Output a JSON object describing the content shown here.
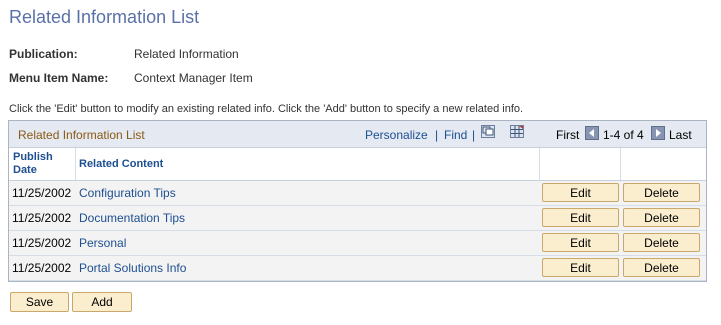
{
  "page": {
    "title": "Related Information List"
  },
  "fields": [
    {
      "label": "Publication:",
      "value": "Related Information"
    },
    {
      "label": "Menu Item Name:",
      "value": "Context Manager Item"
    }
  ],
  "instructions": "Click the 'Edit' button to modify an existing related info. Click the 'Add' button to specify a new related info.",
  "grid": {
    "title": "Related Information List",
    "personalize_label": "Personalize",
    "separator": "|",
    "find_label": "Find",
    "first_label": "First",
    "range_label": "1-4 of 4",
    "last_label": "Last",
    "columns": {
      "publish_date": "Publish\nDate",
      "related_content": "Related Content"
    },
    "rows": [
      {
        "date": "11/25/2002",
        "content": "Configuration Tips",
        "edit": "Edit",
        "delete": "Delete"
      },
      {
        "date": "11/25/2002",
        "content": "Documentation Tips",
        "edit": "Edit",
        "delete": "Delete"
      },
      {
        "date": "11/25/2002",
        "content": "Personal",
        "edit": "Edit",
        "delete": "Delete"
      },
      {
        "date": "11/25/2002",
        "content": "Portal Solutions Info",
        "edit": "Edit",
        "delete": "Delete"
      }
    ]
  },
  "actions": {
    "save_label": "Save",
    "add_label": "Add"
  },
  "icons": {
    "view_all": "view-all-icon",
    "download": "download-to-spreadsheet-icon",
    "previous": "previous-arrow-icon",
    "next": "next-arrow-icon"
  },
  "colors": {
    "title": "#5a70a8",
    "link": "#1d4f91",
    "grid_title": "#8a5a14",
    "button_bg": "#fbeecf"
  }
}
